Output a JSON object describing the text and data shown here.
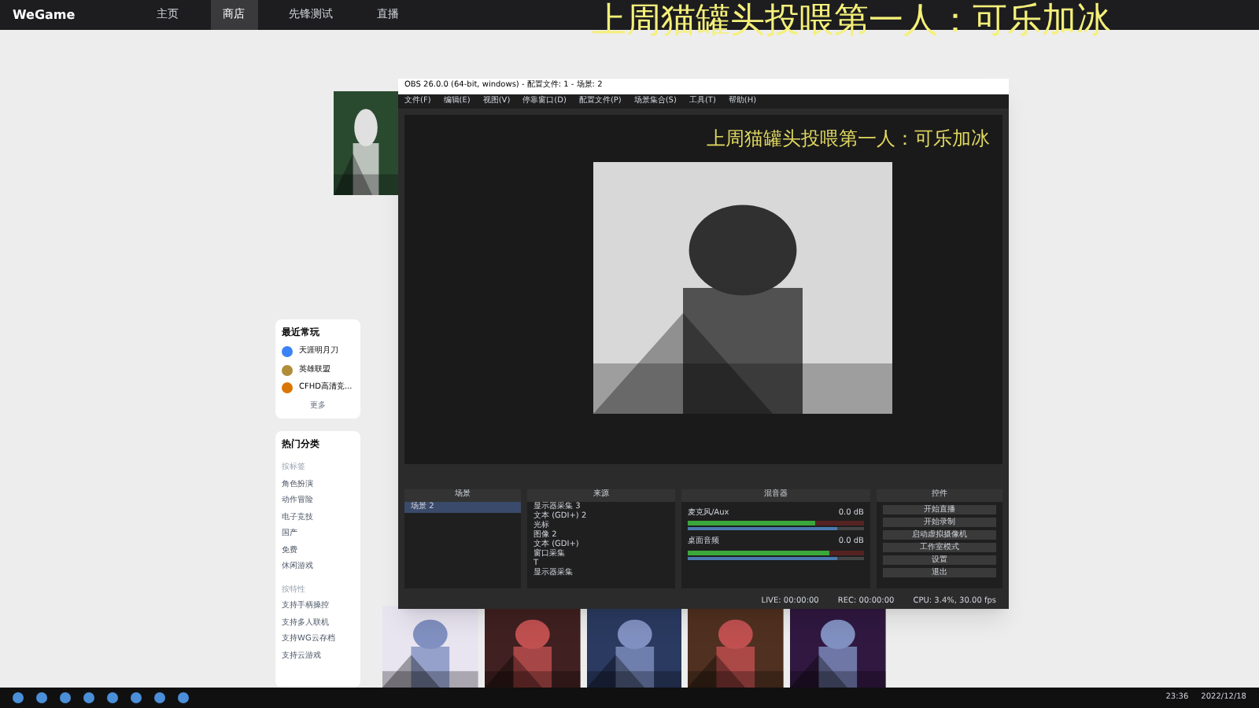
{
  "app": {
    "logo": "WeGame",
    "nav": [
      {
        "label": "主页",
        "selected": false
      },
      {
        "label": "商店",
        "selected": true
      },
      {
        "label": "先锋测试",
        "selected": false
      },
      {
        "label": "直播",
        "selected": false
      }
    ]
  },
  "overlay_text": "上周猫罐头投喂第一人：可乐加冰",
  "sidebar": {
    "recent_title": "最近常玩",
    "recent": [
      {
        "name": "天涯明月刀",
        "color": "#3b82f6"
      },
      {
        "name": "英雄联盟",
        "color": "#b08d3a"
      },
      {
        "name": "CFHD高清竞...",
        "color": "#d97706"
      }
    ],
    "more": "更多",
    "hot_title": "热门分类",
    "group1": "按标签",
    "tags": [
      "角色扮演",
      "动作冒险",
      "电子竞技",
      "国产",
      "免费",
      "休闲游戏"
    ],
    "group2": "按特性",
    "features": [
      "支持手柄操控",
      "支持多人联机",
      "支持WG云存档",
      "支持云游戏"
    ]
  },
  "obs": {
    "title": "OBS 26.0.0 (64-bit, windows) - 配置文件: 1 - 场景: 2",
    "menu": [
      "文件(F)",
      "编辑(E)",
      "视图(V)",
      "停靠窗口(D)",
      "配置文件(P)",
      "场景集合(S)",
      "工具(T)",
      "帮助(H)"
    ],
    "preview_overlay": "上周猫罐头投喂第一人：可乐加冰",
    "scenes_title": "场景",
    "scenes": [
      {
        "name": "场景 2",
        "selected": true
      }
    ],
    "sources_title": "来源",
    "sources": [
      "显示器采集 3",
      "文本 (GDI+) 2",
      "光标",
      "图像 2",
      "文本 (GDI+)",
      "窗口采集",
      "T",
      "显示器采集"
    ],
    "mixer_title": "混音器",
    "channels": [
      {
        "name": "麦克风/Aux",
        "reading": "0.0 dB",
        "level": 0.72,
        "volume": {
          "level": 0.85
        }
      },
      {
        "name": "桌面音频",
        "reading": "0.0 dB",
        "level": 0.8,
        "volume": {
          "level": 0.85
        }
      }
    ],
    "controls_title": "控件",
    "controls": [
      "开始直播",
      "开始录制",
      "启动虚拟摄像机",
      "工作室模式",
      "设置",
      "退出"
    ],
    "status": [
      "LIVE: 00:00:00",
      "REC: 00:00:00",
      "CPU: 3.4%, 30.00 fps"
    ]
  },
  "taskbar": {
    "time": "23:36",
    "date": "2022/12/18"
  }
}
